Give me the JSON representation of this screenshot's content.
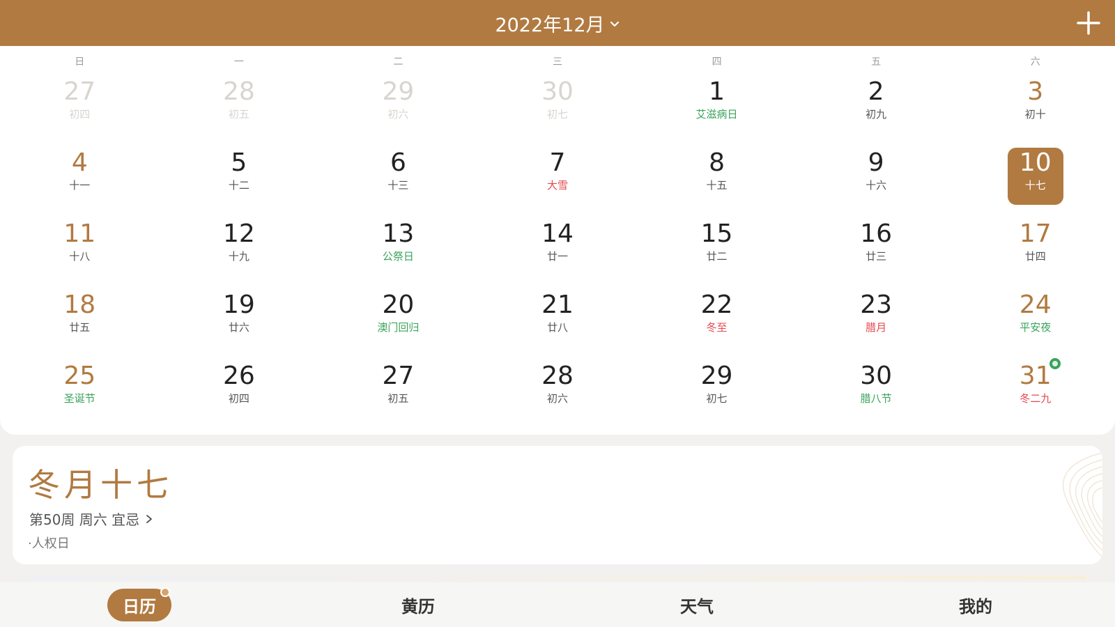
{
  "header": {
    "month_title": "2022年12月",
    "dropdown_icon": "chevron-down-icon",
    "add_icon": "plus-icon",
    "background": "#b17a41"
  },
  "weekdays": [
    "日",
    "一",
    "二",
    "三",
    "四",
    "五",
    "六"
  ],
  "calendar": {
    "selected_day": "10",
    "accent": "#b17a41",
    "days": [
      {
        "num": "27",
        "sub": "初四",
        "other": true
      },
      {
        "num": "28",
        "sub": "初五",
        "other": true
      },
      {
        "num": "29",
        "sub": "初六",
        "other": true
      },
      {
        "num": "30",
        "sub": "初七",
        "other": true
      },
      {
        "num": "1",
        "sub": "艾滋病日",
        "type": "festival"
      },
      {
        "num": "2",
        "sub": "初九"
      },
      {
        "num": "3",
        "sub": "初十"
      },
      {
        "num": "4",
        "sub": "十一"
      },
      {
        "num": "5",
        "sub": "十二"
      },
      {
        "num": "6",
        "sub": "十三"
      },
      {
        "num": "7",
        "sub": "大雪",
        "type": "term"
      },
      {
        "num": "8",
        "sub": "十五"
      },
      {
        "num": "9",
        "sub": "十六"
      },
      {
        "num": "10",
        "sub": "十七",
        "selected": true
      },
      {
        "num": "11",
        "sub": "十八"
      },
      {
        "num": "12",
        "sub": "十九"
      },
      {
        "num": "13",
        "sub": "公祭日",
        "type": "festival"
      },
      {
        "num": "14",
        "sub": "廿一"
      },
      {
        "num": "15",
        "sub": "廿二"
      },
      {
        "num": "16",
        "sub": "廿三"
      },
      {
        "num": "17",
        "sub": "廿四"
      },
      {
        "num": "18",
        "sub": "廿五"
      },
      {
        "num": "19",
        "sub": "廿六"
      },
      {
        "num": "20",
        "sub": "澳门回归",
        "type": "festival"
      },
      {
        "num": "21",
        "sub": "廿八"
      },
      {
        "num": "22",
        "sub": "冬至",
        "type": "term"
      },
      {
        "num": "23",
        "sub": "腊月",
        "type": "term"
      },
      {
        "num": "24",
        "sub": "平安夜",
        "type": "festival"
      },
      {
        "num": "25",
        "sub": "圣诞节",
        "type": "festival"
      },
      {
        "num": "26",
        "sub": "初四"
      },
      {
        "num": "27",
        "sub": "初五"
      },
      {
        "num": "28",
        "sub": "初六"
      },
      {
        "num": "29",
        "sub": "初七"
      },
      {
        "num": "30",
        "sub": "腊八节",
        "type": "festival"
      },
      {
        "num": "31",
        "sub": "冬二九",
        "type": "term",
        "badge": true
      }
    ]
  },
  "info": {
    "lunar_date": "冬月十七",
    "detail": "第50周 周六 宜忌",
    "arrow_icon": "chevron-right-icon",
    "note": "·人权日"
  },
  "bottom_nav": [
    {
      "label": "日历",
      "active": true
    },
    {
      "label": "黄历"
    },
    {
      "label": "天气"
    },
    {
      "label": "我的"
    }
  ]
}
